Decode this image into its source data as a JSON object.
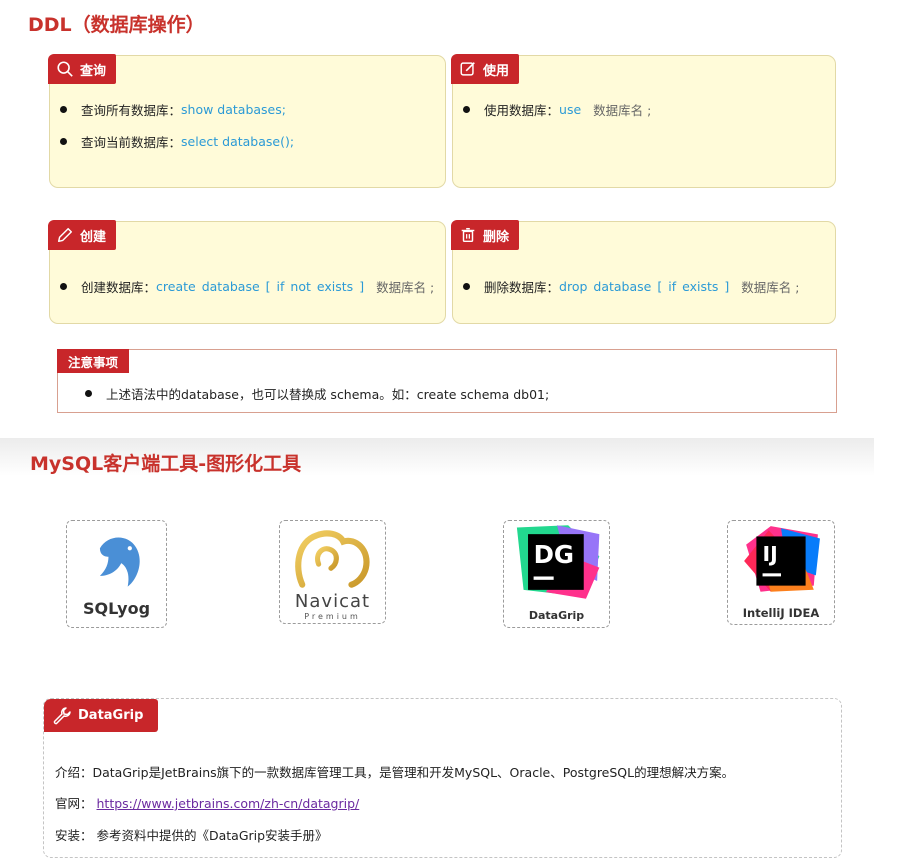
{
  "ddl": {
    "title": "DDL（数据库操作）",
    "query": {
      "tag": "查询",
      "items": [
        {
          "label": "查询所有数据库：",
          "code": "show databases;"
        },
        {
          "label": "查询当前数据库：",
          "code": "select database();"
        }
      ]
    },
    "use": {
      "tag": "使用",
      "label": "使用数据库：",
      "code": "use",
      "suffix": "数据库名 ;"
    },
    "create": {
      "tag": "创建",
      "label": "创建数据库：",
      "kw1": "create",
      "kw2": "database",
      "lb": "[",
      "opt1": "if",
      "opt2": "not",
      "opt3": "exists",
      "rb": "]",
      "suffix": "数据库名 ;"
    },
    "delete": {
      "tag": "删除",
      "label": "删除数据库：",
      "kw1": "drop",
      "kw2": "database",
      "lb": "[",
      "opt1": "if",
      "opt2": "exists",
      "rb": "]",
      "suffix": "数据库名 ;"
    },
    "note": {
      "tag": "注意事项",
      "text": "上述语法中的database，也可以替换成 schema。如：create schema  db01;"
    }
  },
  "tools": {
    "title": "MySQL客户端工具-图形化工具",
    "items": [
      {
        "name": "SQLyog"
      },
      {
        "name": "Navicat",
        "sub": "Premium"
      },
      {
        "name": "DataGrip",
        "logo": "DG"
      },
      {
        "name": "IntelliJ IDEA",
        "logo": "IJ"
      }
    ]
  },
  "datagrip": {
    "tag": "DataGrip",
    "intro": "介绍：DataGrip是JetBrains旗下的一款数据库管理工具，是管理和开发MySQL、Oracle、PostgreSQL的理想解决方案。",
    "site_label": "官网：",
    "site_url": "https://www.jetbrains.com/zh-cn/datagrip/",
    "install": "安装：  参考资料中提供的《DataGrip安装手册》"
  },
  "colors": {
    "accent": "#c8262a",
    "card_bg": "#fffbd9",
    "code": "#2b9ad6",
    "link": "#6b2aa0"
  }
}
